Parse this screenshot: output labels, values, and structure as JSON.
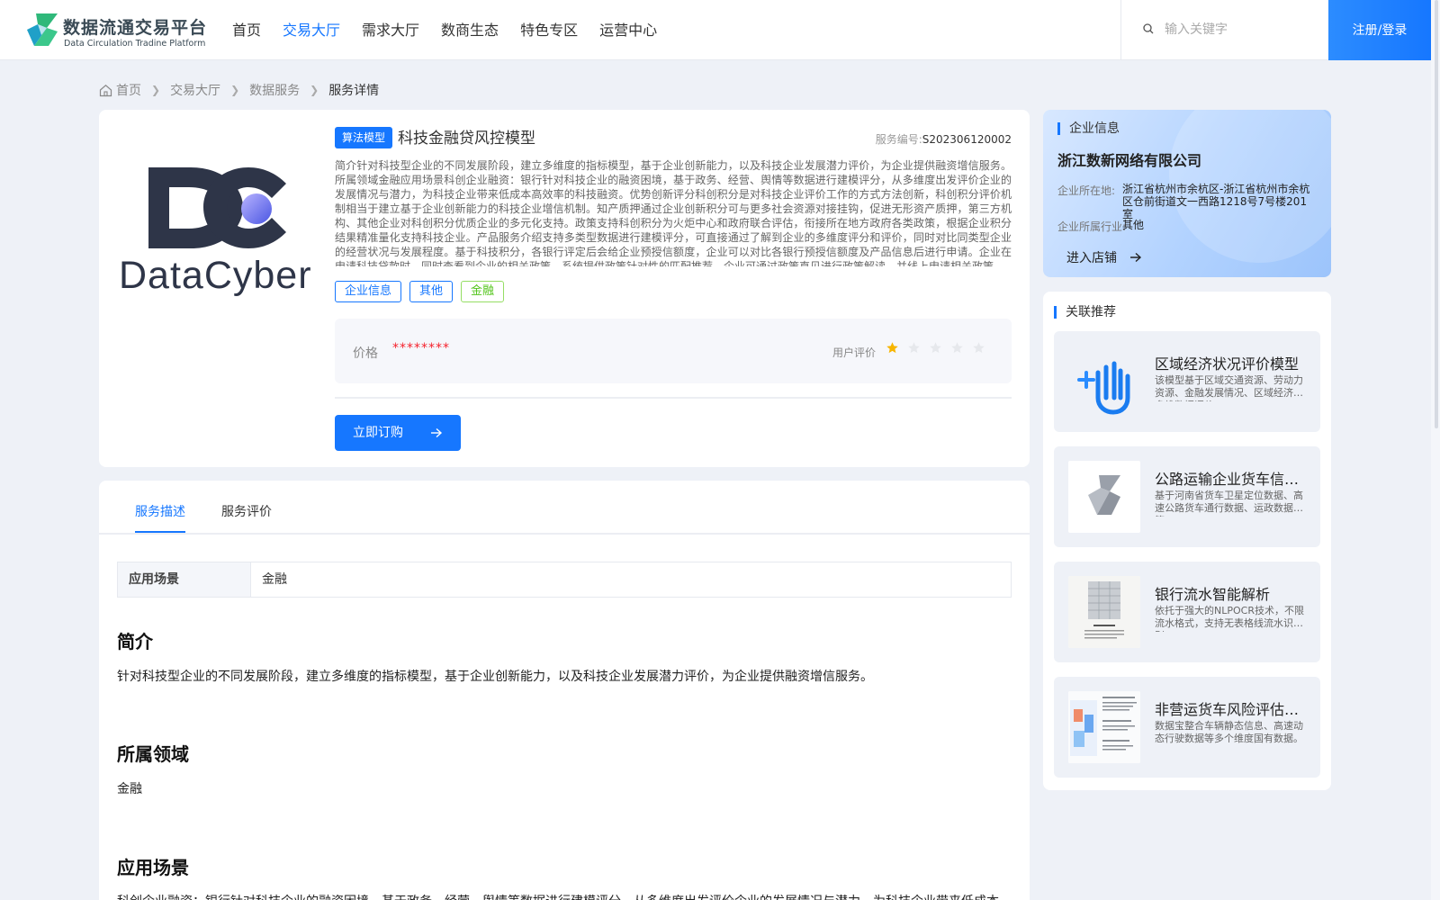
{
  "header": {
    "logo_title": "数据流通交易平台",
    "logo_subtitle": "Data Circulation Tradine Platform",
    "nav": [
      "首页",
      "交易大厅",
      "需求大厅",
      "数商生态",
      "特色专区",
      "运营中心"
    ],
    "active_nav": "交易大厅",
    "search_placeholder": "输入关键字",
    "login_label": "注册/登录"
  },
  "breadcrumb": [
    "首页",
    "交易大厅",
    "数据服务",
    "服务详情"
  ],
  "service": {
    "logo_text": "DataCyber",
    "type_tag": "算法模型",
    "title": "科技金融贷风控模型",
    "number_label": "服务编号:",
    "number": "S202306120002",
    "description": "简介针对科技型企业的不同发展阶段，建立多维度的指标模型，基于企业创新能力，以及科技企业发展潜力评价，为企业提供融资增信服务。所属领域金融应用场景科创企业融资：银行针对科技企业的融资困境，基于政务、经营、舆情等数据进行建模评分，从多维度出发评价企业的发展情况与潜力，为科技企业带来低成本高效率的科技融资。优势创新评分科创积分是对科技企业评价工作的方式方法创新，科创积分评价机制相当于建立基于企业创新能力的科技企业增信机制。知产质押通过企业创新积分可与更多社会资源对接挂钩，促进无形资产质押，第三方机构、其他企业对科创积分优质企业的多元化支持。政策支持科创积分为火炬中心和政府联合评估，衔接所在地方政府各类政策，根据企业积分结果精准量化支持科技企业。产品服务介绍支持多类型数据进行建模评分，可直接通过了解到企业的多维度评分和评价，同时对比同类型企业的经营状况与发展程度。基于科技积分，各银行评定后会给企业预授信额度，企业可以对比各银行预授信额度及产品信息后进行申请。企业在申请科技贷款时，同时查看到企业的相关政策，系统提供政策针对性的匹配推荐，企业可通过政策直见进行政策解读，并线上申请相关政策。",
    "tags": [
      {
        "label": "企业信息",
        "color": "#1677ff"
      },
      {
        "label": "其他",
        "color": "#1677ff"
      },
      {
        "label": "金融",
        "color": "#52c41a"
      }
    ],
    "price_label": "价格",
    "price_value": "********",
    "rating_label": "用户评价",
    "rating_stars": 1,
    "rating_max": 5,
    "buy_label": "立即订购"
  },
  "detail": {
    "tabs": [
      "服务描述",
      "服务评价"
    ],
    "active_tab": "服务描述",
    "scene_key": "应用场景",
    "scene_value": "金融",
    "intro_heading": "简介",
    "intro_text": "针对科技型企业的不同发展阶段，建立多维度的指标模型，基于企业创新能力，以及科技企业发展潜力评价，为企业提供融资增信服务。",
    "domain_heading": "所属领域",
    "domain_text": "金融",
    "scene_heading": "应用场景",
    "scene_text": "科创企业融资：银行针对科技企业的融资困境，基于政务、经营、舆情等数据进行建模评分，从多维度出发评价企业的发展情况与潜力，为科技企业带来低成本"
  },
  "company": {
    "section_title": "企业信息",
    "name": "浙江数新网络有限公司",
    "location_label": "企业所在地:",
    "location": "浙江省杭州市余杭区-浙江省杭州市余杭区仓前街道文一西路1218号7号楼201室",
    "industry_label": "企业所属行业:",
    "industry": "其他",
    "enter_shop": "进入店铺"
  },
  "recommend": {
    "section_title": "关联推荐",
    "items": [
      {
        "title": "区域经济状况评价模型",
        "desc": "该模型基于区域交通资源、劳动力资源、金融发展情况、区域经济等多维数据评价。",
        "thumb": "hand-icon"
      },
      {
        "title": "公路运输企业货车信用评估模型",
        "desc": "基于河南省货车卫星定位数据、高速公路货车通行数据、运政数据等。",
        "thumb": "platform-logo-icon"
      },
      {
        "title": "银行流水智能解析",
        "desc": "依托于强大的NLPOCR技术，不限流水格式，支持无表格线流水识别。",
        "thumb": "document-thumbnail"
      },
      {
        "title": "非营运货车风险评估模型",
        "desc": "数据宝整合车辆静态信息、高速动态行驶数据等多个维度国有数据。",
        "thumb": "report-thumbnail"
      }
    ]
  }
}
